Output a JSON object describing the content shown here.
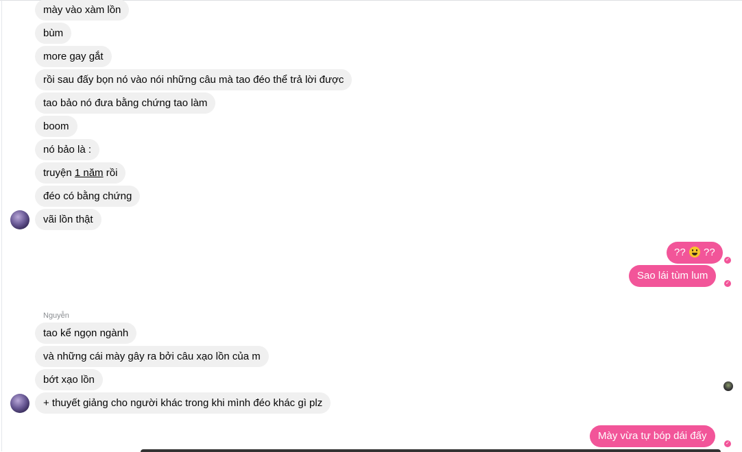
{
  "colors": {
    "incoming_bubble": "#f0f0f0",
    "outgoing_bubble": "#f25599",
    "sender_label": "#8a8d91"
  },
  "messages_group1": [
    {
      "text": "mày vào xàm lồn"
    },
    {
      "text": "bùm"
    },
    {
      "text": "more gay gắt"
    },
    {
      "text": "rồi sau đấy bọn nó vào nói những câu mà tao đéo thể trả lời được"
    },
    {
      "text": "tao bảo nó đưa bằng chứng tao làm"
    },
    {
      "text": "boom"
    },
    {
      "text": "nó bảo là :"
    },
    {
      "pre": "truyện ",
      "link": "1 năm",
      "post": " rồi"
    },
    {
      "text": "đéo có bằng chứng"
    },
    {
      "text": "vãi lồn thật"
    }
  ],
  "outgoing_group1": {
    "msg1_pre": "??",
    "msg1_emoji": "grinning-emoji",
    "msg1_post": "??",
    "msg2": "Sao lái tùm lum"
  },
  "sender_name": "Nguyễn",
  "messages_group2": [
    {
      "text": "tao kể ngọn ngành"
    },
    {
      "text": "và những cái mày gây ra bởi câu xạo lồn của m"
    },
    {
      "text": "bớt xạo lồn"
    },
    {
      "text": "+ thuyết giảng cho người khác trong khi mình đéo khác gì plz"
    }
  ],
  "outgoing_group2": {
    "msg1": "Mày vừa tự bóp dái đấy"
  },
  "icons": {
    "sent_status": "check-circle-icon",
    "seen": "seen-avatar-icon",
    "avatar": "user-avatar-icon"
  }
}
